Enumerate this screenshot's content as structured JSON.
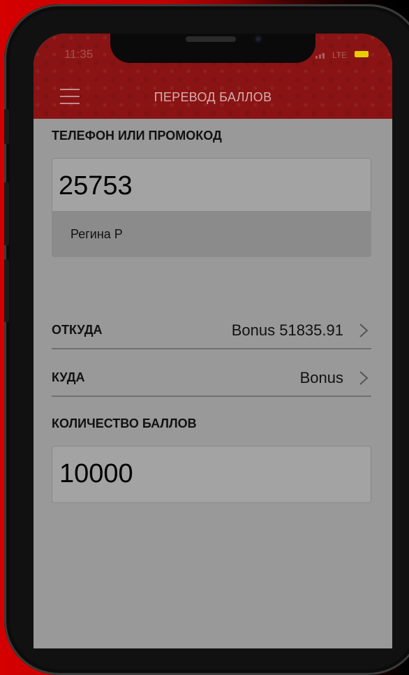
{
  "status_bar": {
    "time": "11:35",
    "network": "LTE",
    "battery_color": "#e8d000"
  },
  "header": {
    "title": "ПЕРЕВОД БАЛЛОВ",
    "menu_icon": "hamburger-menu-icon",
    "background_color": "#8a1414"
  },
  "recipient": {
    "label": "ТЕЛЕФОН ИЛИ ПРОМОКОД",
    "value": "25753",
    "suggestion": "Регина Р"
  },
  "from": {
    "label": "ОТКУДА",
    "value": "Bonus 51835.91",
    "icon": "chevron-right-icon"
  },
  "to": {
    "label": "КУДА",
    "value": "Bonus",
    "icon": "chevron-right-icon"
  },
  "amount": {
    "label": "КОЛИЧЕСТВО БАЛЛОВ",
    "value": "10000"
  }
}
